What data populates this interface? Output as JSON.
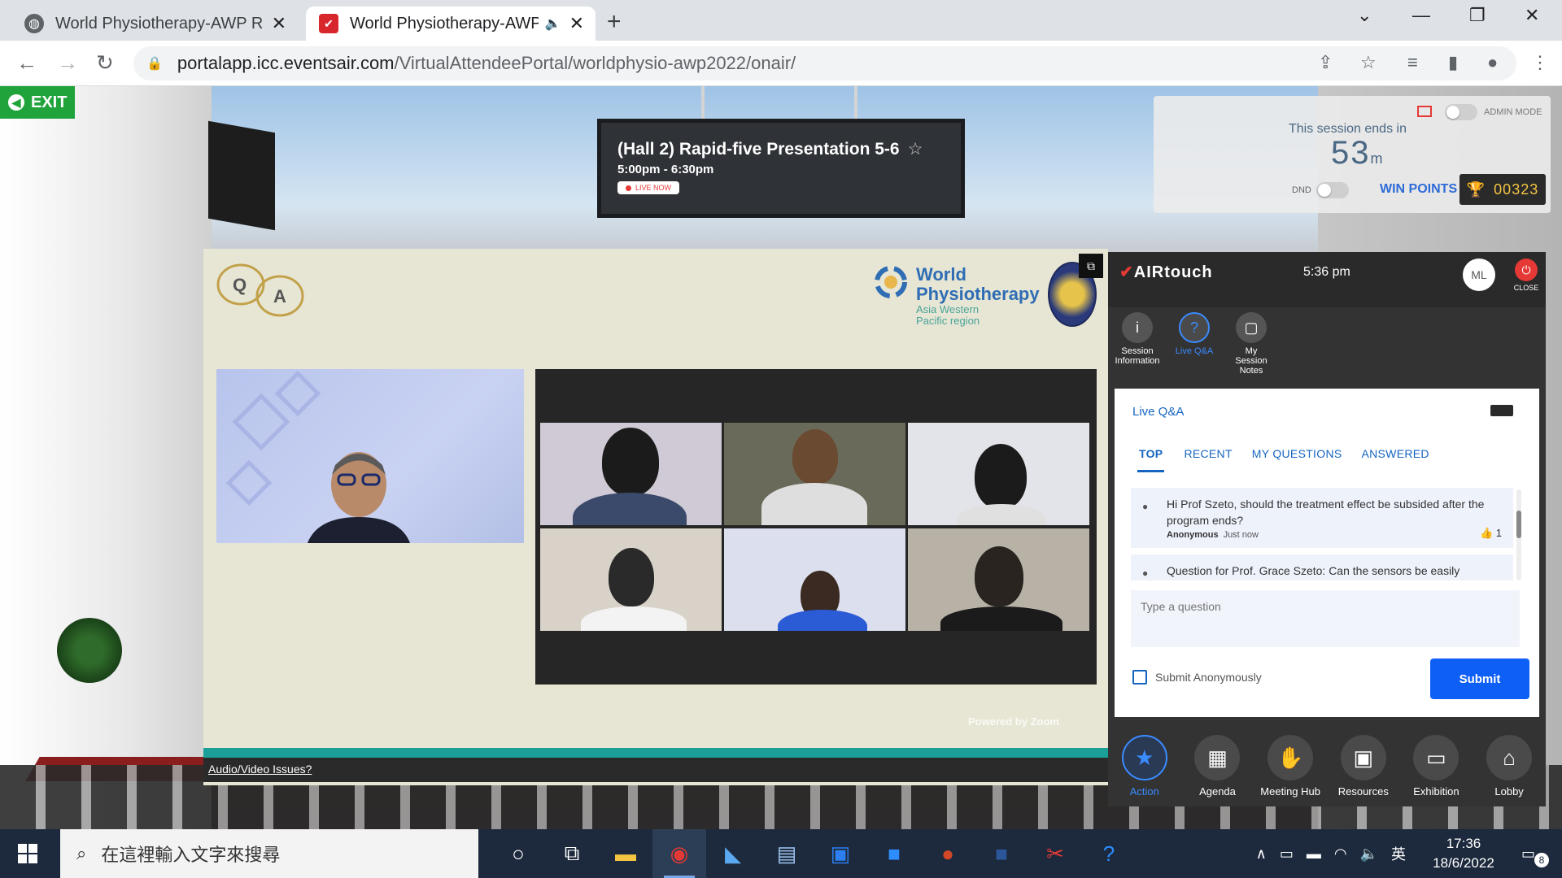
{
  "browser": {
    "tabs": [
      {
        "title": "World Physiotherapy-AWP Reg",
        "active": false
      },
      {
        "title": "World Physiotherapy-AWP",
        "active": true
      }
    ],
    "new_tab": "+",
    "url_host": "portalapp.icc.eventsair.com",
    "url_path": "/VirtualAttendeePortal/worldphysio-awp2022/onair/"
  },
  "exit_label": "EXIT",
  "session_sign": {
    "title": "(Hall 2) Rapid-five Presentation 5-6",
    "time": "5:00pm - 6:30pm",
    "live_label": "LIVE NOW"
  },
  "session_panel": {
    "admin_label": "ADMIN MODE",
    "ends_label": "This session ends in",
    "minutes": "53",
    "minutes_unit": "m",
    "dnd_label": "DND",
    "win_points_label": "WIN POINTS",
    "points": "00323"
  },
  "presentation": {
    "qa_q": "Q",
    "qa_a": "A",
    "org_name_1": "World",
    "org_name_2": "Physiotherapy",
    "region_1": "Asia Western",
    "region_2": "Pacific region",
    "powered_by": "Powered by Zoom",
    "av_issues": "Audio/Video Issues?"
  },
  "airtouch": {
    "brand": "AIRtouch",
    "time": "5:36 pm",
    "avatar_initials": "ML",
    "close_label": "CLOSE",
    "tabs": [
      {
        "label": "Session Information",
        "icon": "info-icon",
        "active": false
      },
      {
        "label": "Live Q&A",
        "icon": "question-icon",
        "active": true
      },
      {
        "label": "My Session Notes",
        "icon": "notes-icon",
        "active": false
      }
    ],
    "qa": {
      "title": "Live Q&A",
      "tabs": [
        "TOP",
        "RECENT",
        "MY QUESTIONS",
        "ANSWERED"
      ],
      "active_tab": "TOP",
      "questions": [
        {
          "text": "Hi Prof Szeto, should the treatment effect be subsided after the program ends?",
          "author": "Anonymous",
          "when": "Just now",
          "likes": "1"
        },
        {
          "text": "Question for Prof. Grace Szeto: Can the sensors be easily",
          "author": "",
          "when": "",
          "likes": ""
        }
      ],
      "input_placeholder": "Type a question",
      "anon_label": "Submit Anonymously",
      "submit_label": "Submit"
    },
    "bottom_nav": [
      {
        "label": "Action",
        "icon": "star-icon",
        "active": true
      },
      {
        "label": "Agenda",
        "icon": "calendar-icon",
        "active": false
      },
      {
        "label": "Meeting Hub",
        "icon": "handshake-icon",
        "active": false
      },
      {
        "label": "Resources",
        "icon": "images-icon",
        "active": false
      },
      {
        "label": "Exhibition",
        "icon": "monitor-icon",
        "active": false
      },
      {
        "label": "Lobby",
        "icon": "home-icon",
        "active": false
      }
    ]
  },
  "taskbar": {
    "search_placeholder": "在這裡輸入文字來搜尋",
    "time": "17:36",
    "date": "18/6/2022",
    "ime": "英",
    "notifications": "8"
  }
}
